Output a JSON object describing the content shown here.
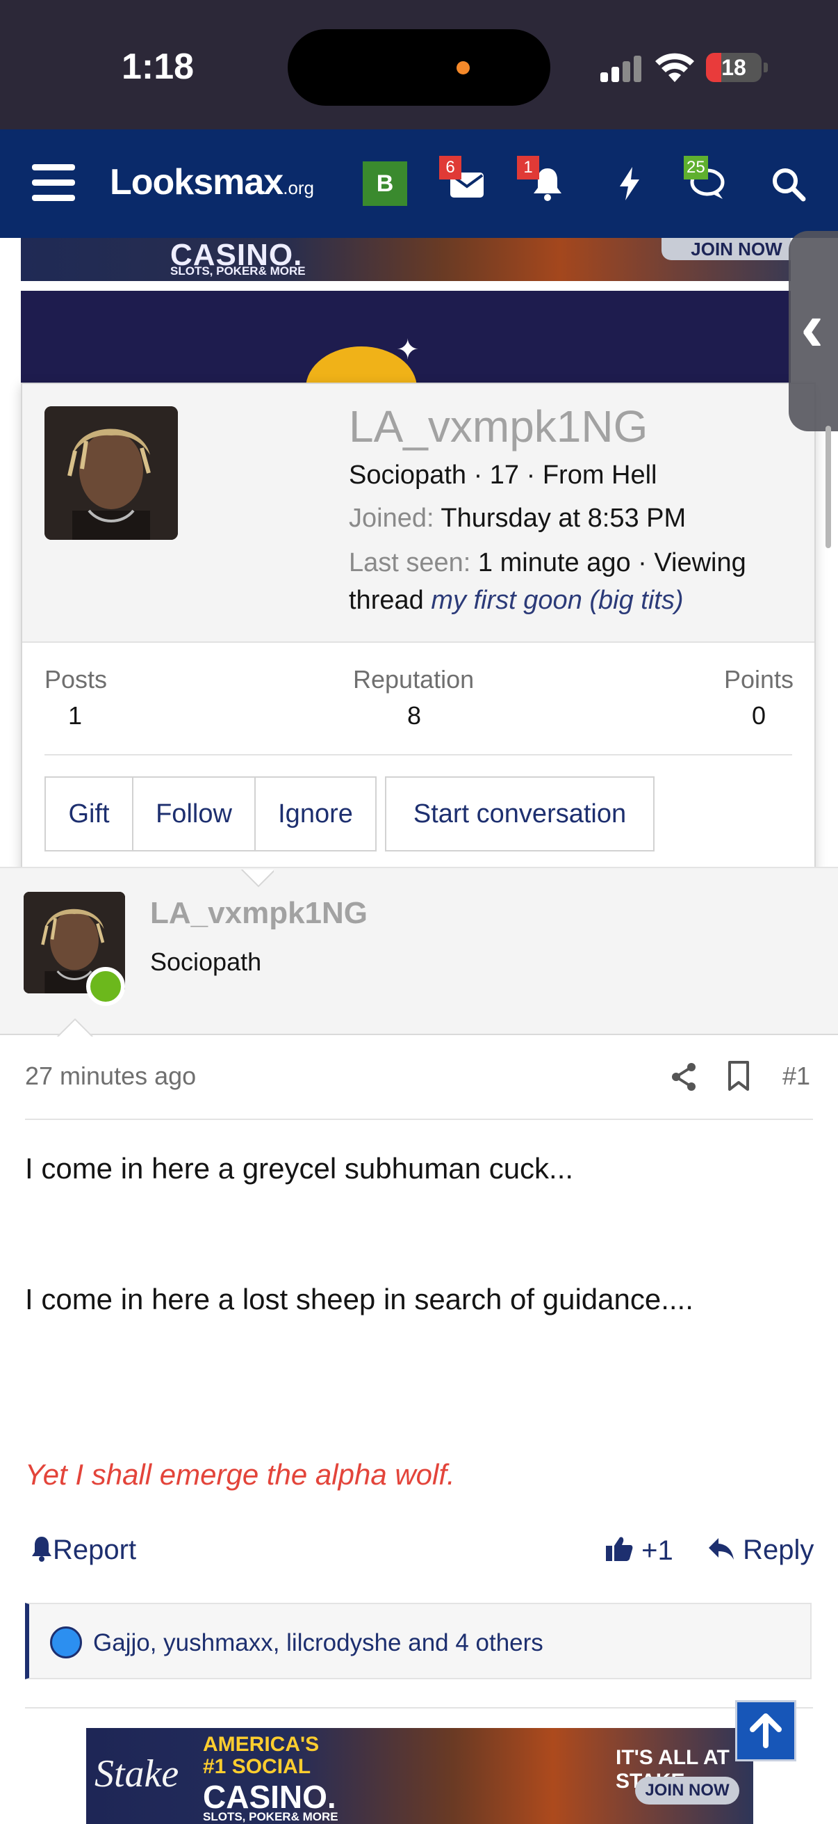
{
  "status_bar": {
    "time": "1:18",
    "battery": "18"
  },
  "nav": {
    "logo_main": "Looksmax",
    "logo_suffix": ".org",
    "bookmark_letter": "B",
    "inbox_badge": "6",
    "alerts_badge": "1",
    "chats_badge": "25",
    "icons": [
      "menu-icon",
      "envelope-icon",
      "bell-icon",
      "lightning-icon",
      "chat-icon",
      "search-icon"
    ]
  },
  "ads": {
    "top_casino": "CASINO.",
    "top_sub": "SLOTS, POKER& MORE",
    "top_join": "JOIN NOW",
    "bottom_stake": "Stake",
    "bottom_line1": "AMERICA'S",
    "bottom_line2": "#1 SOCIAL",
    "bottom_casino": "CASINO.",
    "bottom_sub": "SLOTS, POKER& MORE",
    "bottom_right": "IT'S ALL AT STAKE",
    "bottom_join": "JOIN NOW"
  },
  "profile_card": {
    "username": "LA_vxmpk1NG",
    "title_line": "Sociopath · 17 · From Hell",
    "joined_label": "Joined:",
    "joined_value": "Thursday at 8:53 PM",
    "last_seen_label": "Last seen:",
    "last_seen_value": "1 minute ago · Viewing",
    "viewing_prefix": "thread",
    "viewing_thread": "my first goon (big tits)",
    "stats": {
      "posts_label": "Posts",
      "posts_value": "1",
      "reputation_label": "Reputation",
      "reputation_value": "8",
      "points_label": "Points",
      "points_value": "0"
    },
    "buttons": {
      "gift": "Gift",
      "follow": "Follow",
      "ignore": "Ignore",
      "start_conversation": "Start conversation"
    }
  },
  "post": {
    "username": "LA_vxmpk1NG",
    "user_title": "Sociopath",
    "time": "27 minutes ago",
    "number": "#1",
    "lines": [
      "I come in here a greycel subhuman cuck...",
      "I come in here a lost sheep in search of guidance...."
    ],
    "emphasis_line": "Yet I shall emerge the alpha wolf.",
    "report_label": "Report",
    "like_count": "+1",
    "reply_label": "Reply",
    "likes_text": "Gajjo, yushmaxx, lilcrodyshe and 4 others"
  },
  "colors": {
    "nav_bg": "#0a2a6a",
    "link": "#1d2f6f",
    "emphasis_red": "#e3443a",
    "online_green": "#6cb81c"
  }
}
